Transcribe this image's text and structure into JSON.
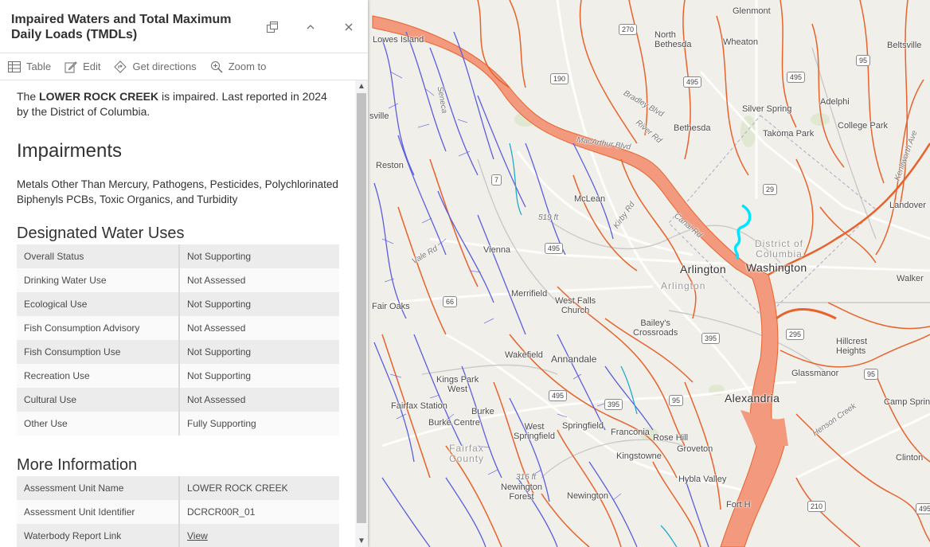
{
  "panel": {
    "title": "Impaired Waters and Total Maximum Daily Loads (TMDLs)",
    "toolbar": {
      "table": "Table",
      "edit": "Edit",
      "directions": "Get directions",
      "zoom": "Zoom to"
    },
    "intro_pre": "The ",
    "intro_bold": "LOWER ROCK CREEK",
    "intro_post": " is impaired. Last reported in 2024 by the District of Columbia.",
    "impairments_heading": "Impairments",
    "impairments_text": "Metals Other Than Mercury, Pathogens, Pesticides, Polychlorinated Biphenyls PCBs, Toxic Organics, and Turbidity",
    "uses_heading": "Designated Water Uses",
    "uses": [
      {
        "name": "Overall Status",
        "value": "Not Supporting"
      },
      {
        "name": "Drinking Water Use",
        "value": "Not Assessed"
      },
      {
        "name": "Ecological Use",
        "value": "Not Supporting"
      },
      {
        "name": "Fish Consumption Advisory",
        "value": "Not Assessed"
      },
      {
        "name": "Fish Consumption Use",
        "value": "Not Supporting"
      },
      {
        "name": "Recreation Use",
        "value": "Not Supporting"
      },
      {
        "name": "Cultural Use",
        "value": "Not Assessed"
      },
      {
        "name": "Other Use",
        "value": "Fully Supporting"
      }
    ],
    "more_heading": "More Information",
    "more": [
      {
        "name": "Assessment Unit Name",
        "value": "LOWER ROCK CREEK"
      },
      {
        "name": "Assessment Unit Identifier",
        "value": "DCRCR00R_01"
      },
      {
        "name": "Waterbody Report Link",
        "value": "View"
      }
    ]
  },
  "map": {
    "places": {
      "lowes_island": "Lowes Island",
      "north_bethesda": "North\nBethesda",
      "glenmont": "Glenmont",
      "wheaton": "Wheaton",
      "beltsville": "Beltsville",
      "adelphi": "Adelphi",
      "silver_spring": "Silver Spring",
      "takoma_park": "Takoma Park",
      "college_park": "College Park",
      "bethesda": "Bethesda",
      "reston": "Reston",
      "herndon_partial": "sville",
      "mclean": "McLean",
      "landover": "Landover",
      "district_of_columbia": "District of\nColumbia",
      "washington": "Washington",
      "arlington": "Arlington",
      "arlington_region": "Arlington",
      "vienna": "Vienna",
      "fair_oaks": "Fair Oaks",
      "merrifield": "Merrifield",
      "west_falls_church": "West Falls\nChurch",
      "baileys_crossroads": "Bailey's\nCrossroads",
      "walker_partial": "Walker",
      "hillcrest_heights": "Hillcrest\nHeights",
      "glassmanor": "Glassmanor",
      "wakefield": "Wakefield",
      "annandale": "Annandale",
      "kings_park_west": "Kings Park\nWest",
      "fairfax_station": "Fairfax Station",
      "burke": "Burke",
      "burke_centre": "Burke Centre",
      "west_springfield": "West\nSpringfield",
      "springfield": "Springfield",
      "franconia": "Franconia",
      "rose_hill": "Rose Hill",
      "groveton": "Groveton",
      "alexandria": "Alexandria",
      "camp_springs": "Camp Spring",
      "kingstowne": "Kingstowne",
      "huntington_partial": "Hybla Valley",
      "newington_forest": "Newington\nForest",
      "newington": "Newington",
      "fort_hunt": "Fort H",
      "clinton": "Clinton",
      "fairfax_region": "Fairfax\nCounty"
    },
    "roads": {
      "macarthur": "MacArthur Blvd",
      "river_rd": "River Rd",
      "bradley_blvd": "Bradley Blvd",
      "canal_rd": "Canal Rd",
      "kirby_rd": "Kirby Rd",
      "vale_rd": "Vale Rd",
      "elev_519": "519 ft",
      "elev_316": "316 ft",
      "henson_creek": "Henson Creek",
      "kenilworth": "Kenilworth Ave",
      "seneca": "Seneca"
    },
    "shields": [
      "270",
      "190",
      "495",
      "495",
      "95",
      "29",
      "7",
      "495",
      "66",
      "395",
      "295",
      "95",
      "495",
      "395",
      "95",
      "210",
      "495"
    ],
    "colors": {
      "impaired": "#e8622c",
      "assessed_good": "#5a5ee0",
      "highlight": "#00e5ff",
      "water": "#f39a7e",
      "land": "#f1efe9"
    }
  }
}
